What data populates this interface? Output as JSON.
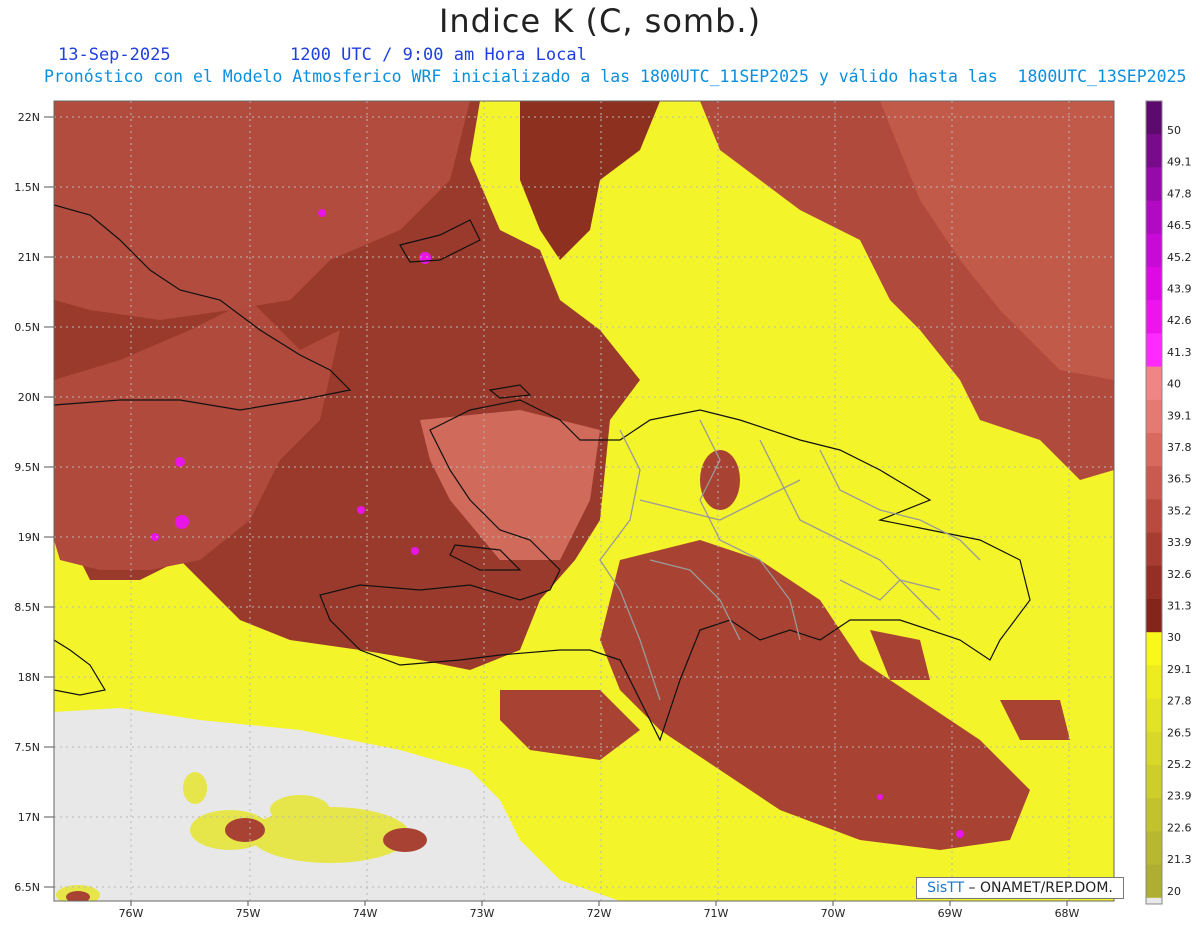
{
  "header": {
    "title": "Indice K (C, somb.)",
    "date": "13-Sep-2025",
    "time": "1200 UTC / 9:00 am Hora Local",
    "description": "Pronóstico con el Modelo Atmosferico WRF inicializado a las 1800UTC_11SEP2025 y válido hasta las  1800UTC_13SEP2025"
  },
  "map": {
    "lat_labels": [
      "22N",
      "1.5N",
      "21N",
      "0.5N",
      "20N",
      "9.5N",
      "19N",
      "8.5N",
      "18N",
      "7.5N",
      "17N",
      "6.5N"
    ],
    "lon_labels": [
      "76W",
      "75W",
      "74W",
      "73W",
      "72W",
      "71W",
      "70W",
      "69W",
      "68W"
    ]
  },
  "colorbar": {
    "labels": [
      "50",
      "49.1",
      "47.8",
      "46.5",
      "45.2",
      "43.9",
      "42.6",
      "41.3",
      "40",
      "39.1",
      "37.8",
      "36.5",
      "35.2",
      "33.9",
      "32.6",
      "31.3",
      "30",
      "29.1",
      "27.8",
      "26.5",
      "25.2",
      "23.9",
      "22.6",
      "21.3",
      "20"
    ],
    "colors": [
      "#5c0a6e",
      "#7a0a8c",
      "#950aa8",
      "#b00ac4",
      "#c80ad6",
      "#de0ae4",
      "#ee14ee",
      "#ff2aff",
      "#f08585",
      "#e57a72",
      "#d8695f",
      "#c95a50",
      "#b84a40",
      "#a63c32",
      "#952f26",
      "#84251c",
      "#f8f81a",
      "#ecec20",
      "#e2e226",
      "#d8d82a",
      "#cdcd2c",
      "#c2c22e",
      "#b8b830",
      "#aeae32"
    ],
    "no_data_color": "#e8e8e8"
  },
  "credit": {
    "brand": "SisTT",
    "text": "– ONAMET/REP.DOM."
  }
}
